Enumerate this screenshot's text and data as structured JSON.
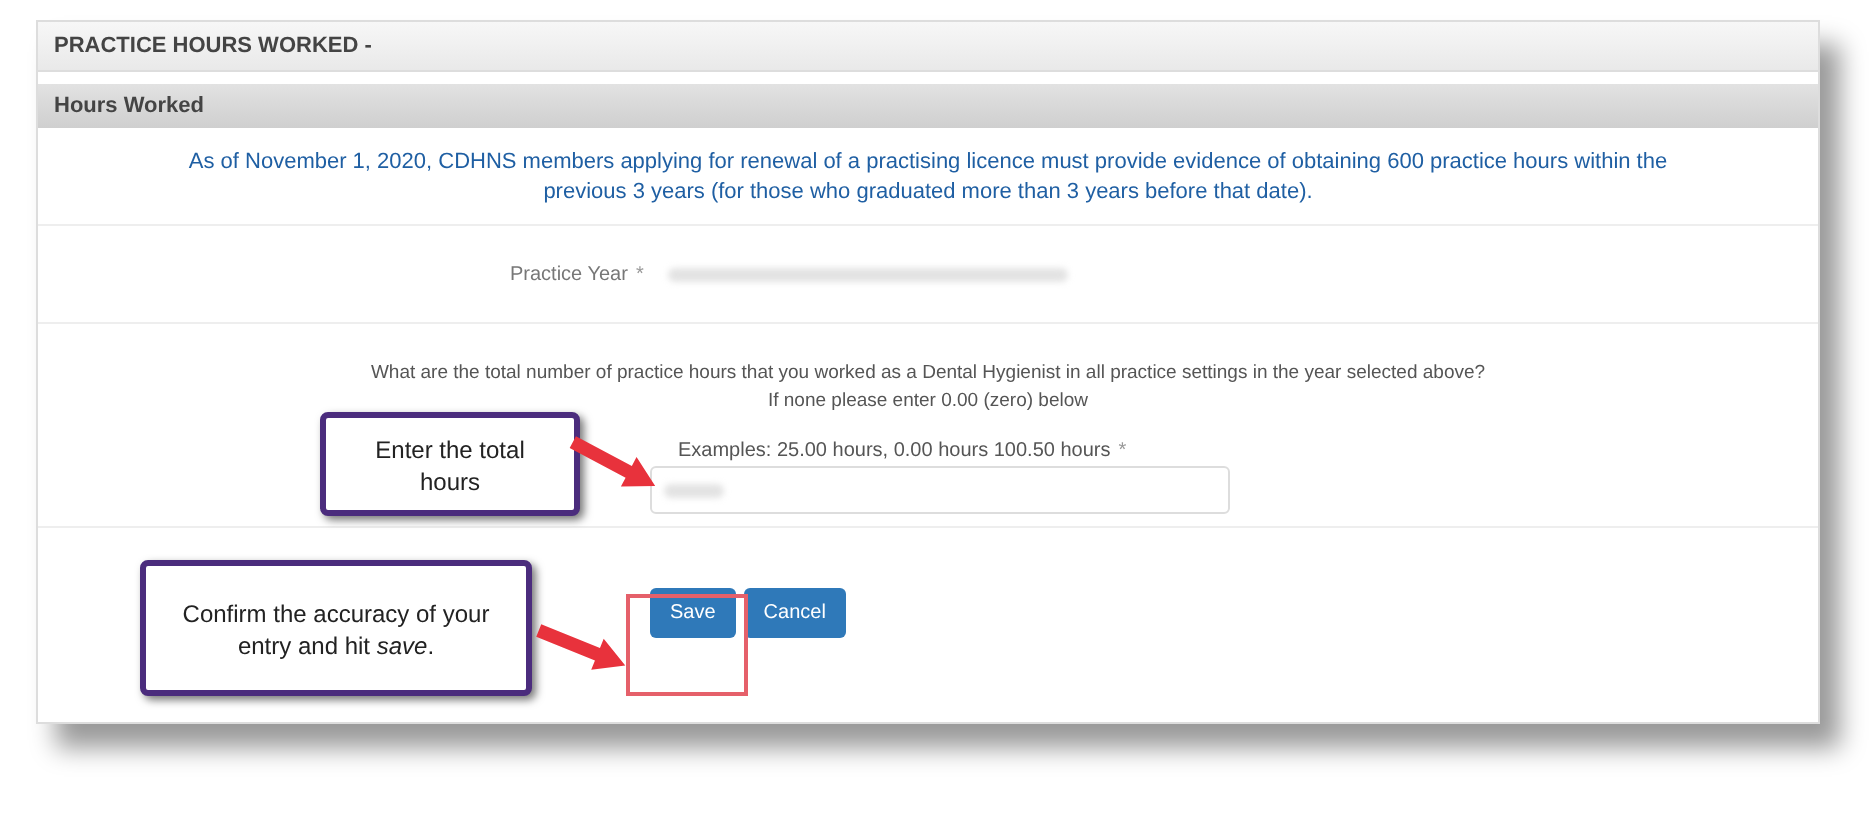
{
  "panel": {
    "title": "PRACTICE HOURS WORKED -"
  },
  "section": {
    "title": "Hours Worked"
  },
  "notice": [
    "As of November 1, 2020, CDHNS members applying for renewal of a practising licence must provide evidence of obtaining 600 practice hours within the",
    "previous 3 years (for those who graduated more than 3 years before that date)."
  ],
  "practice_year": {
    "label": "Practice Year",
    "required_mark": "*"
  },
  "question": [
    "What are the total number of practice hours that you worked as a Dental Hygienist in all practice settings in the year selected above?",
    "If none please enter 0.00 (zero) below"
  ],
  "hours_field": {
    "label": "Examples: 25.00 hours, 0.00 hours 100.50 hours",
    "required_mark": "*"
  },
  "buttons": [
    {
      "label": "Save",
      "kind": "primary"
    },
    {
      "label": "Cancel",
      "kind": "primary"
    }
  ],
  "callouts": [
    {
      "text": "Enter the total hours",
      "kind": "field"
    },
    {
      "text": "Confirm the accuracy of your entry and hit *save*.",
      "kind": "save"
    }
  ]
}
